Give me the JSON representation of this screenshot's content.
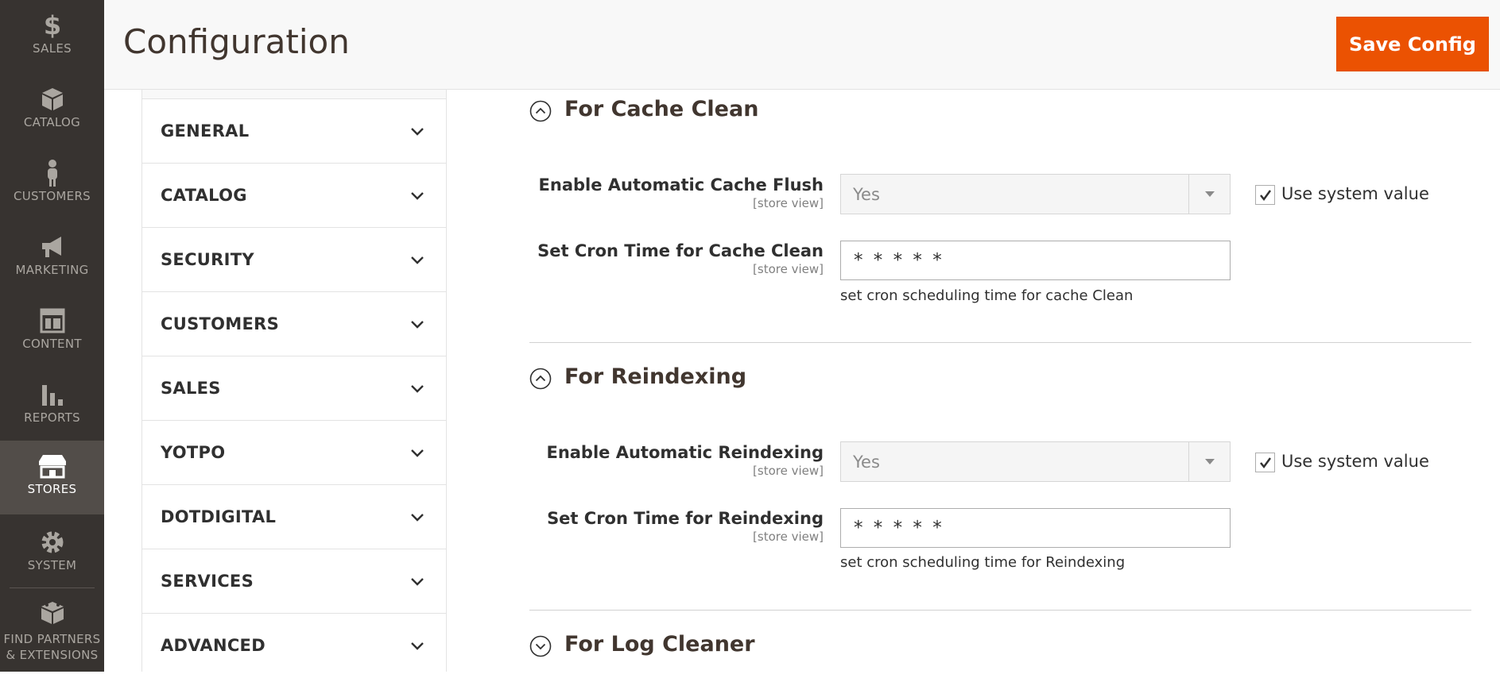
{
  "menu": {
    "items": [
      {
        "label": "SALES",
        "icon": "dollar-icon"
      },
      {
        "label": "CATALOG",
        "icon": "box-icon"
      },
      {
        "label": "CUSTOMERS",
        "icon": "person-icon"
      },
      {
        "label": "MARKETING",
        "icon": "megaphone-icon"
      },
      {
        "label": "CONTENT",
        "icon": "layout-icon"
      },
      {
        "label": "REPORTS",
        "icon": "bar-chart-icon"
      },
      {
        "label": "STORES",
        "icon": "storefront-icon",
        "active": true
      },
      {
        "label": "SYSTEM",
        "icon": "gear-icon"
      },
      {
        "label": "FIND PARTNERS & EXTENSIONS",
        "line1": "FIND PARTNERS",
        "line2": "& EXTENSIONS",
        "icon": "blocks-icon"
      }
    ]
  },
  "header": {
    "title": "Configuration",
    "save_label": "Save Config"
  },
  "tabs": [
    "GENERAL",
    "CATALOG",
    "SECURITY",
    "CUSTOMERS",
    "SALES",
    "YOTPO",
    "DOTDIGITAL",
    "SERVICES",
    "ADVANCED"
  ],
  "sections": {
    "cache": {
      "title": "For Cache Clean",
      "enable_label": "Enable Automatic Cache Flush",
      "enable_scope": "[store view]",
      "enable_value": "Yes",
      "use_system_value": "Use system value",
      "cron_label": "Set Cron Time for Cache Clean",
      "cron_scope": "[store view]",
      "cron_value": "* * * * *",
      "cron_note": "set cron scheduling time for cache Clean"
    },
    "reindex": {
      "title": "For Reindexing",
      "enable_label": "Enable Automatic Reindexing",
      "enable_scope": "[store view]",
      "enable_value": "Yes",
      "use_system_value": "Use system value",
      "cron_label": "Set Cron Time for Reindexing",
      "cron_scope": "[store view]",
      "cron_value": "* * * * *",
      "cron_note": "set cron scheduling time for Reindexing"
    },
    "log": {
      "title": "For Log Cleaner"
    }
  },
  "colors": {
    "menu_bg": "#373330",
    "menu_active": "#524d49",
    "accent": "#eb5202"
  }
}
